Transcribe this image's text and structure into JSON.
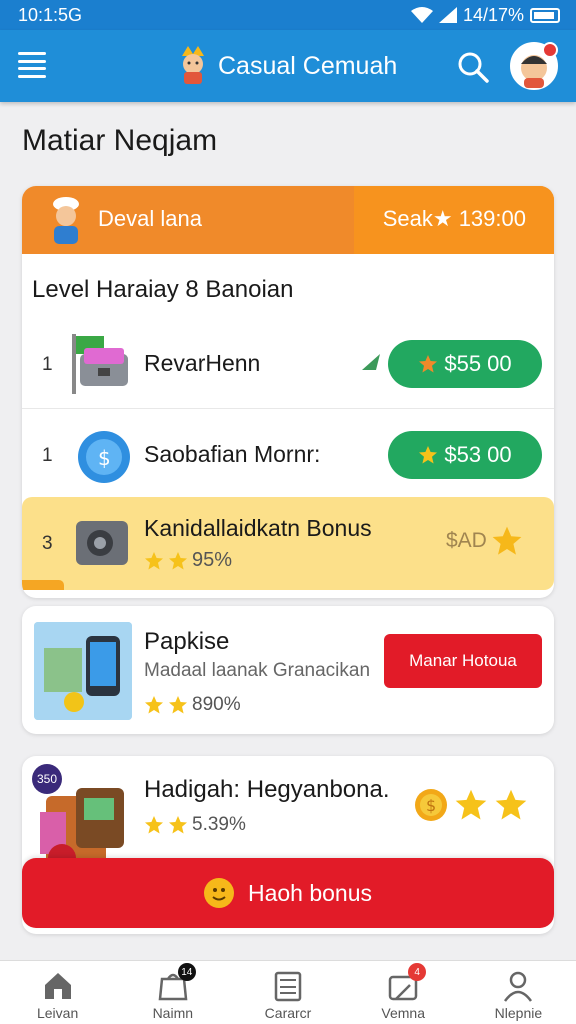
{
  "status_bar": {
    "time": "10:1:5G",
    "battery": "14/17%"
  },
  "app_bar": {
    "title": "Casual Cemuah"
  },
  "page_title": "Matiar Neqjam",
  "promo": {
    "label": "Deval lana",
    "score": "Seak★ 139:00"
  },
  "section_heading": "Level Haraiay 8 Banoian",
  "items": [
    {
      "rank": "1",
      "name": "RevarHenn",
      "price": "$55 00"
    },
    {
      "rank": "1",
      "name": "Saobafian Mornr:",
      "price": "$53 00"
    },
    {
      "rank": "3",
      "name": "Kanidallaidkatn Bonus",
      "rating": "95%",
      "price": "$AD"
    }
  ],
  "card_two": {
    "title": "Papkise",
    "subtitle": "Madaal laanak Granacikan",
    "rating": "890%",
    "button": "Manar Hotoua"
  },
  "card_three": {
    "badge": "350",
    "title": "Hadigah: Hegyanbona.",
    "rating": "5.39%",
    "button": "Haoh bonus"
  },
  "bottom_nav": [
    {
      "label": "Leivan",
      "icon": "home-icon"
    },
    {
      "label": "Naimn",
      "icon": "bag-icon",
      "badge": "14"
    },
    {
      "label": "Cararcr",
      "icon": "calculator-icon"
    },
    {
      "label": "Vemna",
      "icon": "gift-icon",
      "badge": "4"
    },
    {
      "label": "Nlepnie",
      "icon": "person-icon"
    }
  ],
  "colors": {
    "app_bar": "#1f8ed8",
    "promo": "#f08a2a",
    "price_green": "#22a860",
    "red": "#e21b28",
    "highlight": "#fce08a"
  }
}
